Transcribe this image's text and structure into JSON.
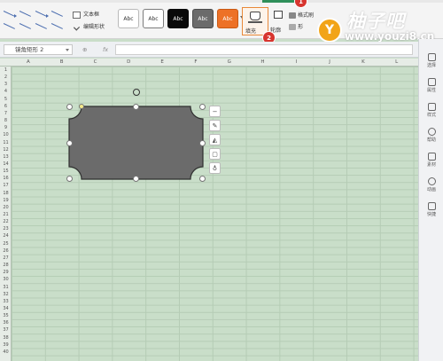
{
  "ribbon": {
    "text_box_label": "文本框",
    "edit_shape_label": "编辑形状",
    "style_samples": [
      {
        "label": "Abc",
        "bg": "#ffffff",
        "fg": "#333333",
        "border": "#b9b9b9"
      },
      {
        "label": "Abc",
        "bg": "#ffffff",
        "fg": "#333333",
        "border": "#7c7c7c"
      },
      {
        "label": "Abc",
        "bg": "#0a0a0a",
        "fg": "#ffffff",
        "border": "#0a0a0a"
      },
      {
        "label": "Abc",
        "bg": "#6b6b6b",
        "fg": "#ffffff",
        "border": "#4c4c4c"
      },
      {
        "label": "Abc",
        "bg": "#ed7127",
        "fg": "#ffffff",
        "border": "#c95a14"
      }
    ],
    "fill_label": "填充",
    "outline_label": "轮廓",
    "format_brush_label": "格式刷",
    "attribute_label": "形"
  },
  "badges": {
    "step1": "1",
    "step2": "2"
  },
  "watermark": {
    "logo_letter": "Y",
    "brand": "柚子吧",
    "url": "www.youzi8.cn"
  },
  "formula_bar": {
    "name_box": "镜角矩形 2",
    "fx": "fx"
  },
  "columns": [
    "A",
    "B",
    "C",
    "D",
    "E",
    "F",
    "G",
    "H",
    "I",
    "J",
    "K",
    "L"
  ],
  "rows": [
    "1",
    "2",
    "3",
    "4",
    "5",
    "6",
    "7",
    "8",
    "9",
    "10",
    "11",
    "12",
    "13",
    "14",
    "15",
    "16",
    "17",
    "18",
    "19",
    "20",
    "21",
    "22",
    "23",
    "24",
    "25",
    "26",
    "27",
    "28",
    "29",
    "30",
    "31",
    "32",
    "33",
    "34",
    "35",
    "36",
    "37",
    "38",
    "39",
    "40"
  ],
  "shape": {
    "fill": "#6b6b6b",
    "stroke": "#2f2f2f"
  },
  "float_tools": [
    {
      "name": "collapse",
      "glyph": "−"
    },
    {
      "name": "pen",
      "glyph": "✎"
    },
    {
      "name": "fill",
      "glyph": "◭"
    },
    {
      "name": "outline",
      "glyph": "▢"
    },
    {
      "name": "bulb",
      "glyph": "♁"
    }
  ],
  "right_panel": [
    {
      "label": "选择"
    },
    {
      "label": "属性"
    },
    {
      "label": "样式"
    },
    {
      "label": "帮助"
    },
    {
      "label": "素材"
    },
    {
      "label": "动画"
    },
    {
      "label": "快捷"
    }
  ]
}
